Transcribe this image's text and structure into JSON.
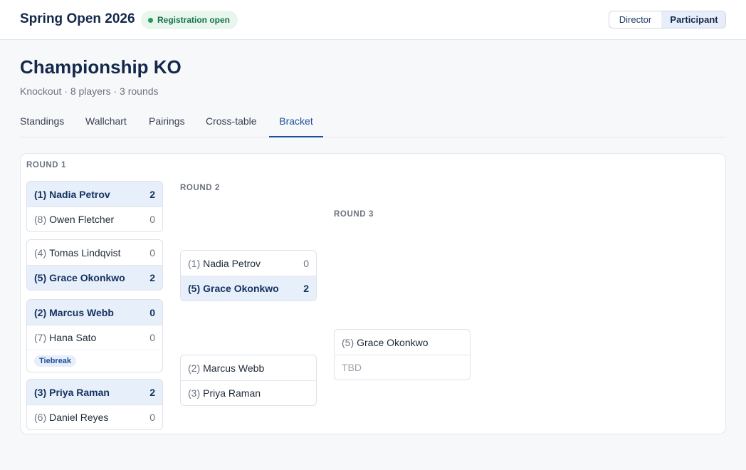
{
  "header": {
    "title": "Spring Open 2026",
    "status": "Registration open",
    "roles": [
      "Director",
      "Participant"
    ],
    "active_role": "Participant"
  },
  "event": {
    "title": "Championship KO",
    "subtitle": "Knockout · 8 players · 3 rounds"
  },
  "tabs": [
    {
      "label": "Standings"
    },
    {
      "label": "Wallchart"
    },
    {
      "label": "Pairings"
    },
    {
      "label": "Cross-table"
    },
    {
      "label": "Bracket",
      "active": true
    }
  ],
  "bracket": {
    "tiebreak_label": "Tiebreak",
    "rounds": [
      {
        "label": "ROUND 1",
        "matches": [
          {
            "players": [
              {
                "seed": "(1)",
                "name": "Nadia Petrov",
                "score": "2",
                "winner": true
              },
              {
                "seed": "(8)",
                "name": "Owen Fletcher",
                "score": "0",
                "winner": false
              }
            ]
          },
          {
            "players": [
              {
                "seed": "(4)",
                "name": "Tomas Lindqvist",
                "score": "0",
                "winner": false
              },
              {
                "seed": "(5)",
                "name": "Grace Okonkwo",
                "score": "2",
                "winner": true
              }
            ]
          },
          {
            "players": [
              {
                "seed": "(2)",
                "name": "Marcus Webb",
                "score": "0",
                "winner": true
              },
              {
                "seed": "(7)",
                "name": "Hana Sato",
                "score": "0",
                "winner": false
              }
            ],
            "tiebreak": true
          },
          {
            "players": [
              {
                "seed": "(3)",
                "name": "Priya Raman",
                "score": "2",
                "winner": true
              },
              {
                "seed": "(6)",
                "name": "Daniel Reyes",
                "score": "0",
                "winner": false
              }
            ]
          }
        ]
      },
      {
        "label": "ROUND 2",
        "matches": [
          {
            "players": [
              {
                "seed": "(1)",
                "name": "Nadia Petrov",
                "score": "0",
                "winner": false
              },
              {
                "seed": "(5)",
                "name": "Grace Okonkwo",
                "score": "2",
                "winner": true
              }
            ]
          },
          {
            "players": [
              {
                "seed": "(2)",
                "name": "Marcus Webb",
                "score": "",
                "winner": false
              },
              {
                "seed": "(3)",
                "name": "Priya Raman",
                "score": "",
                "winner": false
              }
            ]
          }
        ]
      },
      {
        "label": "ROUND 3",
        "matches": [
          {
            "players": [
              {
                "seed": "(5)",
                "name": "Grace Okonkwo",
                "score": "",
                "winner": false
              },
              {
                "seed": "",
                "name": "TBD",
                "score": "",
                "winner": false,
                "tbd": true
              }
            ]
          }
        ]
      }
    ]
  }
}
